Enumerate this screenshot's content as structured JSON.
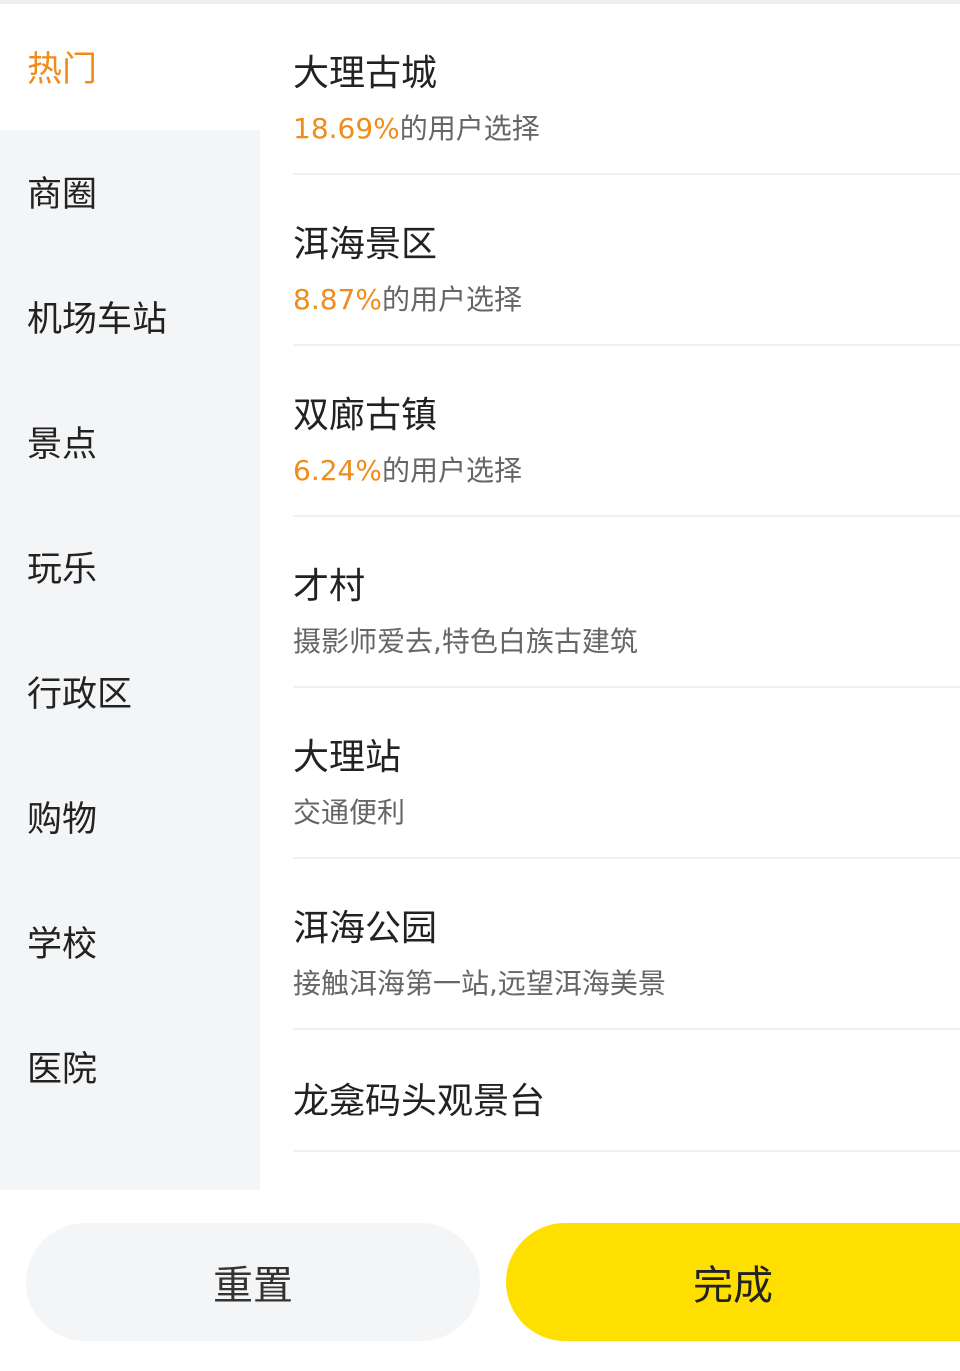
{
  "categories": [
    "热门",
    "商圈",
    "机场车站",
    "景点",
    "玩乐",
    "行政区",
    "购物",
    "学校",
    "医院"
  ],
  "items": [
    {
      "title": "大理古城",
      "percent": "18.69%",
      "suffix": "的用户选择"
    },
    {
      "title": "洱海景区",
      "percent": "8.87%",
      "suffix": "的用户选择"
    },
    {
      "title": "双廊古镇",
      "percent": "6.24%",
      "suffix": "的用户选择"
    },
    {
      "title": "才村",
      "subtitle": "摄影师爱去,特色白族古建筑"
    },
    {
      "title": "大理站",
      "subtitle": "交通便利"
    },
    {
      "title": "洱海公园",
      "subtitle": "接触洱海第一站,远望洱海美景"
    },
    {
      "title": "龙龛码头观景台"
    }
  ],
  "buttons": {
    "reset": "重置",
    "done": "完成"
  },
  "colors": {
    "accent": "#f08c1a",
    "primary_button": "#ffdf00",
    "sidebar_bg": "#f4f5f7"
  }
}
